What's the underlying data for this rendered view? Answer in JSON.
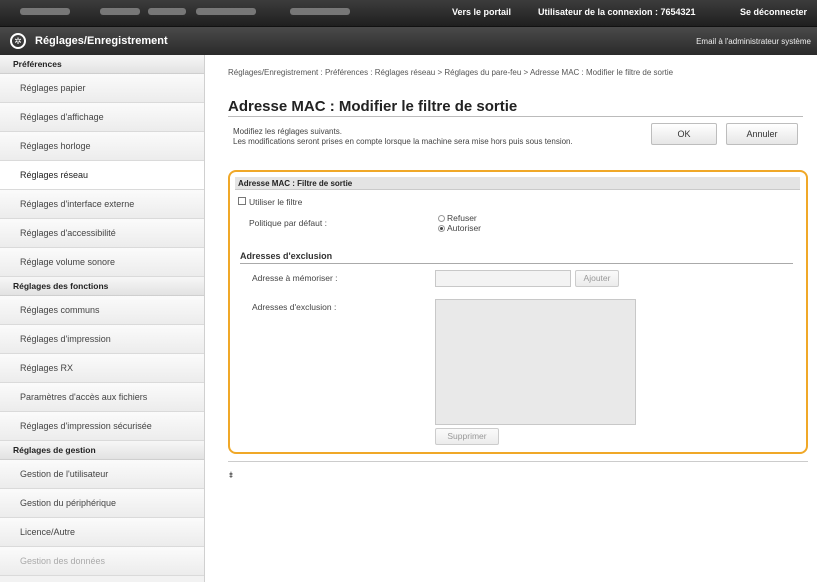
{
  "topbar": {
    "portal_link": "Vers le portail",
    "login_user": "Utilisateur de la connexion : 7654321",
    "logout": "Se déconnecter"
  },
  "header": {
    "title": "Réglages/Enregistrement",
    "admin_mail": "Email à l'administrateur système"
  },
  "sidebar": {
    "sections": [
      {
        "title": "Préférences",
        "items": [
          "Réglages papier",
          "Réglages d'affichage",
          "Réglages horloge",
          "Réglages réseau",
          "Réglages d'interface externe",
          "Réglages d'accessibilité",
          "Réglage volume sonore"
        ]
      },
      {
        "title": "Réglages des fonctions",
        "items": [
          "Réglages communs",
          "Réglages d'impression",
          "Réglages RX",
          "Paramètres d'accès aux fichiers",
          "Réglages d'impression sécurisée"
        ]
      },
      {
        "title": "Réglages de gestion",
        "items": [
          "Gestion de l'utilisateur",
          "Gestion du périphérique",
          "Licence/Autre",
          "Gestion des données"
        ]
      }
    ],
    "active_item": "Réglages réseau"
  },
  "main": {
    "breadcrumb": "Réglages/Enregistrement : Préférences : Réglages réseau > Réglages du pare-feu > Adresse MAC : Modifier le filtre de sortie",
    "page_title": "Adresse MAC : Modifier le filtre de sortie",
    "description_line1": "Modifiez les réglages suivants.",
    "description_line2": "Les modifications seront prises en compte lorsque la machine sera mise hors puis sous tension.",
    "ok_label": "OK",
    "cancel_label": "Annuler",
    "panel": {
      "title": "Adresse MAC : Filtre de sortie",
      "use_filter_label": "Utiliser le filtre",
      "use_filter_checked": false,
      "default_policy_label": "Politique par défaut :",
      "policy_options": [
        "Refuser",
        "Autoriser"
      ],
      "policy_selected": "Autoriser",
      "exclusion_heading": "Adresses d'exclusion",
      "address_to_store_label": "Adresse à mémoriser :",
      "address_to_store_value": "",
      "add_label": "Ajouter",
      "exclusion_list_label": "Adresses d'exclusion :",
      "exclusion_list": [],
      "delete_label": "Supprimer"
    },
    "to_top_icon": "to-top-icon"
  }
}
